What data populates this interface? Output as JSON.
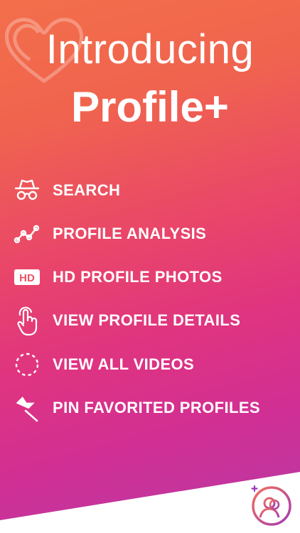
{
  "header": {
    "intro": "Introducing",
    "brand": "Profile+"
  },
  "features": [
    {
      "label": "SEARCH",
      "icon": "incognito-icon"
    },
    {
      "label": "PROFILE ANALYSIS",
      "icon": "analytics-line-icon"
    },
    {
      "label": "HD PROFILE PHOTOS",
      "icon": "hd-icon"
    },
    {
      "label": "VIEW PROFILE DETAILS",
      "icon": "tap-finger-icon"
    },
    {
      "label": "VIEW ALL VIDEOS",
      "icon": "dashed-circle-icon"
    },
    {
      "label": "PIN FAVORITED PROFILES",
      "icon": "pushpin-icon"
    }
  ],
  "colors": {
    "gradient_top": "#f36f4a",
    "gradient_mid": "#df3480",
    "gradient_bottom": "#b53aa7",
    "text": "#ffffff"
  }
}
